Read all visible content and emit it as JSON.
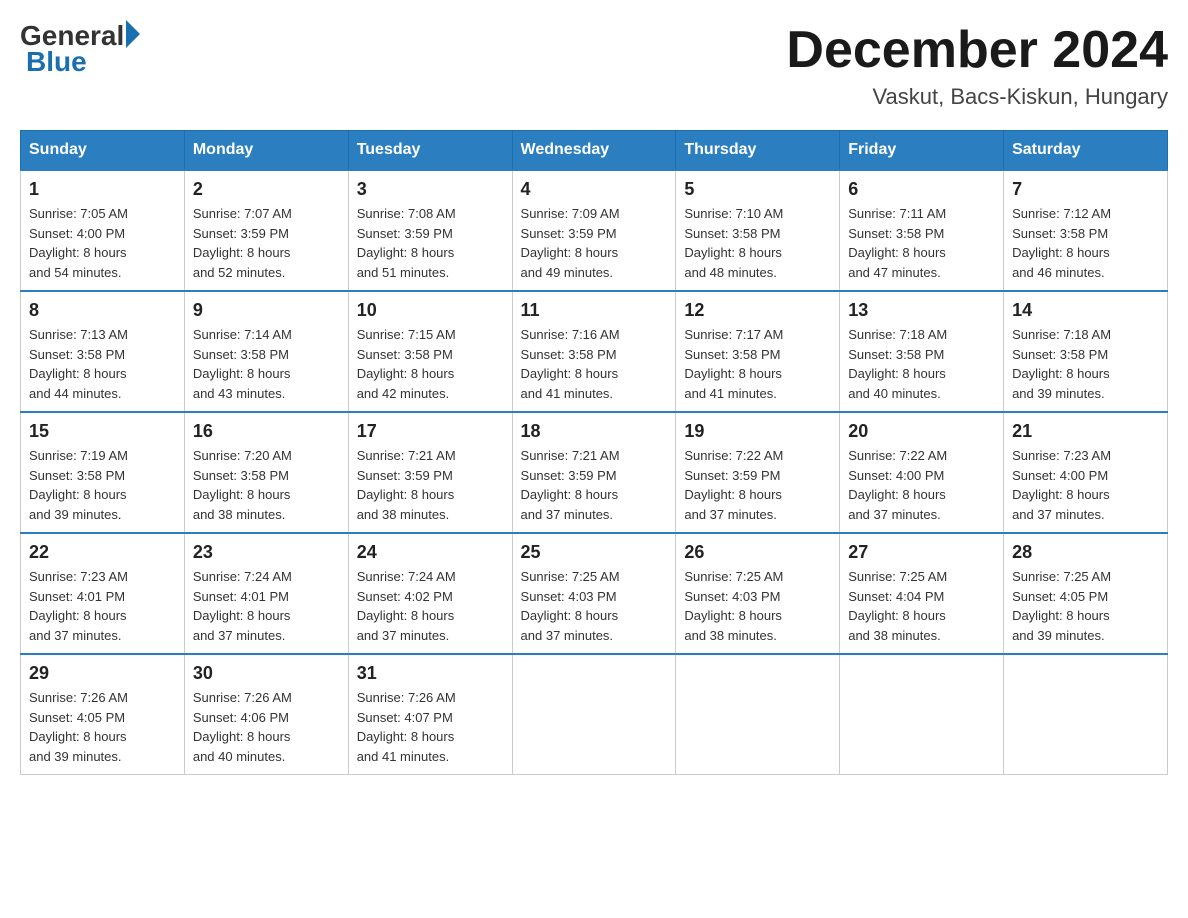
{
  "header": {
    "logo_general": "General",
    "logo_blue": "Blue",
    "month_title": "December 2024",
    "subtitle": "Vaskut, Bacs-Kiskun, Hungary"
  },
  "days_of_week": [
    "Sunday",
    "Monday",
    "Tuesday",
    "Wednesday",
    "Thursday",
    "Friday",
    "Saturday"
  ],
  "weeks": [
    [
      {
        "day": "1",
        "info": "Sunrise: 7:05 AM\nSunset: 4:00 PM\nDaylight: 8 hours\nand 54 minutes."
      },
      {
        "day": "2",
        "info": "Sunrise: 7:07 AM\nSunset: 3:59 PM\nDaylight: 8 hours\nand 52 minutes."
      },
      {
        "day": "3",
        "info": "Sunrise: 7:08 AM\nSunset: 3:59 PM\nDaylight: 8 hours\nand 51 minutes."
      },
      {
        "day": "4",
        "info": "Sunrise: 7:09 AM\nSunset: 3:59 PM\nDaylight: 8 hours\nand 49 minutes."
      },
      {
        "day": "5",
        "info": "Sunrise: 7:10 AM\nSunset: 3:58 PM\nDaylight: 8 hours\nand 48 minutes."
      },
      {
        "day": "6",
        "info": "Sunrise: 7:11 AM\nSunset: 3:58 PM\nDaylight: 8 hours\nand 47 minutes."
      },
      {
        "day": "7",
        "info": "Sunrise: 7:12 AM\nSunset: 3:58 PM\nDaylight: 8 hours\nand 46 minutes."
      }
    ],
    [
      {
        "day": "8",
        "info": "Sunrise: 7:13 AM\nSunset: 3:58 PM\nDaylight: 8 hours\nand 44 minutes."
      },
      {
        "day": "9",
        "info": "Sunrise: 7:14 AM\nSunset: 3:58 PM\nDaylight: 8 hours\nand 43 minutes."
      },
      {
        "day": "10",
        "info": "Sunrise: 7:15 AM\nSunset: 3:58 PM\nDaylight: 8 hours\nand 42 minutes."
      },
      {
        "day": "11",
        "info": "Sunrise: 7:16 AM\nSunset: 3:58 PM\nDaylight: 8 hours\nand 41 minutes."
      },
      {
        "day": "12",
        "info": "Sunrise: 7:17 AM\nSunset: 3:58 PM\nDaylight: 8 hours\nand 41 minutes."
      },
      {
        "day": "13",
        "info": "Sunrise: 7:18 AM\nSunset: 3:58 PM\nDaylight: 8 hours\nand 40 minutes."
      },
      {
        "day": "14",
        "info": "Sunrise: 7:18 AM\nSunset: 3:58 PM\nDaylight: 8 hours\nand 39 minutes."
      }
    ],
    [
      {
        "day": "15",
        "info": "Sunrise: 7:19 AM\nSunset: 3:58 PM\nDaylight: 8 hours\nand 39 minutes."
      },
      {
        "day": "16",
        "info": "Sunrise: 7:20 AM\nSunset: 3:58 PM\nDaylight: 8 hours\nand 38 minutes."
      },
      {
        "day": "17",
        "info": "Sunrise: 7:21 AM\nSunset: 3:59 PM\nDaylight: 8 hours\nand 38 minutes."
      },
      {
        "day": "18",
        "info": "Sunrise: 7:21 AM\nSunset: 3:59 PM\nDaylight: 8 hours\nand 37 minutes."
      },
      {
        "day": "19",
        "info": "Sunrise: 7:22 AM\nSunset: 3:59 PM\nDaylight: 8 hours\nand 37 minutes."
      },
      {
        "day": "20",
        "info": "Sunrise: 7:22 AM\nSunset: 4:00 PM\nDaylight: 8 hours\nand 37 minutes."
      },
      {
        "day": "21",
        "info": "Sunrise: 7:23 AM\nSunset: 4:00 PM\nDaylight: 8 hours\nand 37 minutes."
      }
    ],
    [
      {
        "day": "22",
        "info": "Sunrise: 7:23 AM\nSunset: 4:01 PM\nDaylight: 8 hours\nand 37 minutes."
      },
      {
        "day": "23",
        "info": "Sunrise: 7:24 AM\nSunset: 4:01 PM\nDaylight: 8 hours\nand 37 minutes."
      },
      {
        "day": "24",
        "info": "Sunrise: 7:24 AM\nSunset: 4:02 PM\nDaylight: 8 hours\nand 37 minutes."
      },
      {
        "day": "25",
        "info": "Sunrise: 7:25 AM\nSunset: 4:03 PM\nDaylight: 8 hours\nand 37 minutes."
      },
      {
        "day": "26",
        "info": "Sunrise: 7:25 AM\nSunset: 4:03 PM\nDaylight: 8 hours\nand 38 minutes."
      },
      {
        "day": "27",
        "info": "Sunrise: 7:25 AM\nSunset: 4:04 PM\nDaylight: 8 hours\nand 38 minutes."
      },
      {
        "day": "28",
        "info": "Sunrise: 7:25 AM\nSunset: 4:05 PM\nDaylight: 8 hours\nand 39 minutes."
      }
    ],
    [
      {
        "day": "29",
        "info": "Sunrise: 7:26 AM\nSunset: 4:05 PM\nDaylight: 8 hours\nand 39 minutes."
      },
      {
        "day": "30",
        "info": "Sunrise: 7:26 AM\nSunset: 4:06 PM\nDaylight: 8 hours\nand 40 minutes."
      },
      {
        "day": "31",
        "info": "Sunrise: 7:26 AM\nSunset: 4:07 PM\nDaylight: 8 hours\nand 41 minutes."
      },
      {
        "day": "",
        "info": ""
      },
      {
        "day": "",
        "info": ""
      },
      {
        "day": "",
        "info": ""
      },
      {
        "day": "",
        "info": ""
      }
    ]
  ]
}
